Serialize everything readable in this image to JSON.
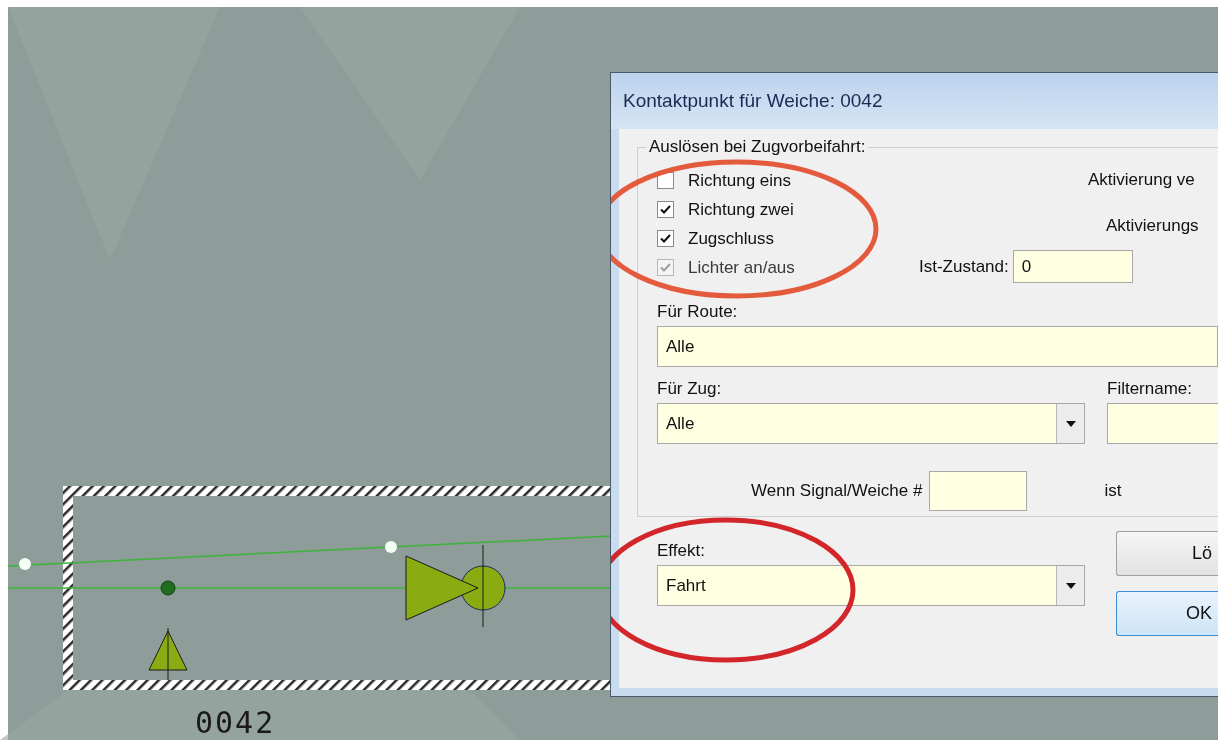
{
  "canvas": {
    "element_label": "0042"
  },
  "dialog": {
    "title": "Kontaktpunkt für Weiche: 0042",
    "trigger_group": {
      "legend": "Auslösen bei Zugvorbeifahrt:",
      "options": [
        {
          "label": "Richtung eins",
          "checked": false,
          "disabled": false
        },
        {
          "label": "Richtung zwei",
          "checked": true,
          "disabled": false
        },
        {
          "label": "Zugschluss",
          "checked": true,
          "disabled": false
        },
        {
          "label": "Lichter an/aus",
          "checked": true,
          "disabled": true
        }
      ]
    },
    "activation_label_1": "Aktivierung ve",
    "activation_label_2": "Aktivierungs",
    "current_state": {
      "label": "Ist-Zustand:",
      "value": "0"
    },
    "route": {
      "label": "Für Route:",
      "value": "Alle"
    },
    "train": {
      "label": "Für Zug:",
      "value": "Alle"
    },
    "filter_name": {
      "label": "Filtername:"
    },
    "condition": {
      "label": "Wenn Signal/Weiche #",
      "suffix": "ist"
    },
    "effect": {
      "label": "Effekt:",
      "value": "Fahrt"
    },
    "buttons": [
      {
        "label": "Lö",
        "default": false
      },
      {
        "label": "OK",
        "default": true
      }
    ]
  }
}
